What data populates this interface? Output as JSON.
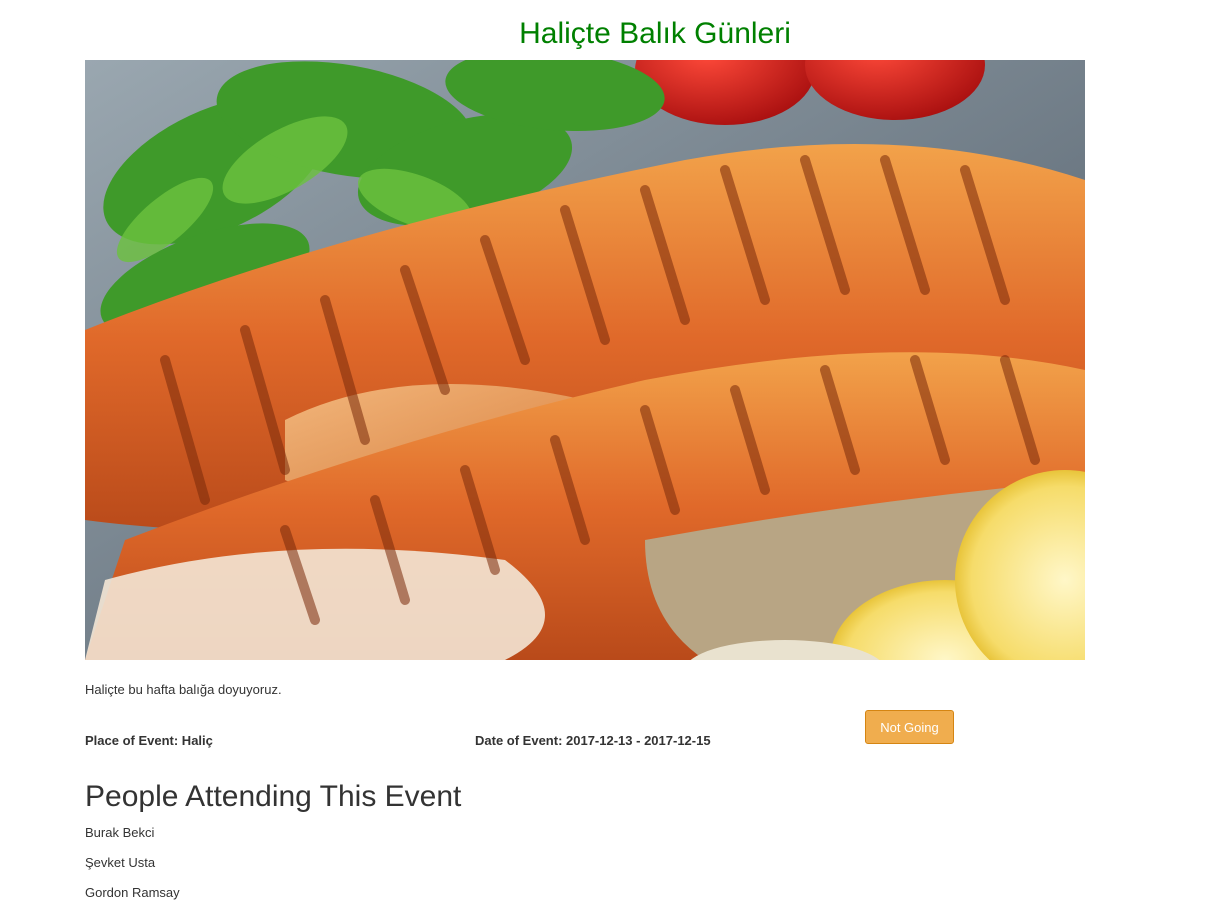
{
  "event": {
    "title": "Haliçte Balık Günleri",
    "description": "Haliçte bu hafta balığa doyuyoruz.",
    "place_text": "Place of Event: Haliç",
    "date_text": "Date of Event: 2017-12-13 - 2017-12-15"
  },
  "rsvp": {
    "label": "Not Going"
  },
  "attendees": {
    "heading": "People Attending This Event",
    "names": [
      "Burak Bekci",
      "Şevket Usta",
      "Gordon Ramsay"
    ]
  },
  "colors": {
    "title": "#008000",
    "button": "#f0ad4e",
    "text": "#333333"
  },
  "image": {
    "subject": "grilled salmon steak with parsley, tomatoes and lemon slices"
  }
}
